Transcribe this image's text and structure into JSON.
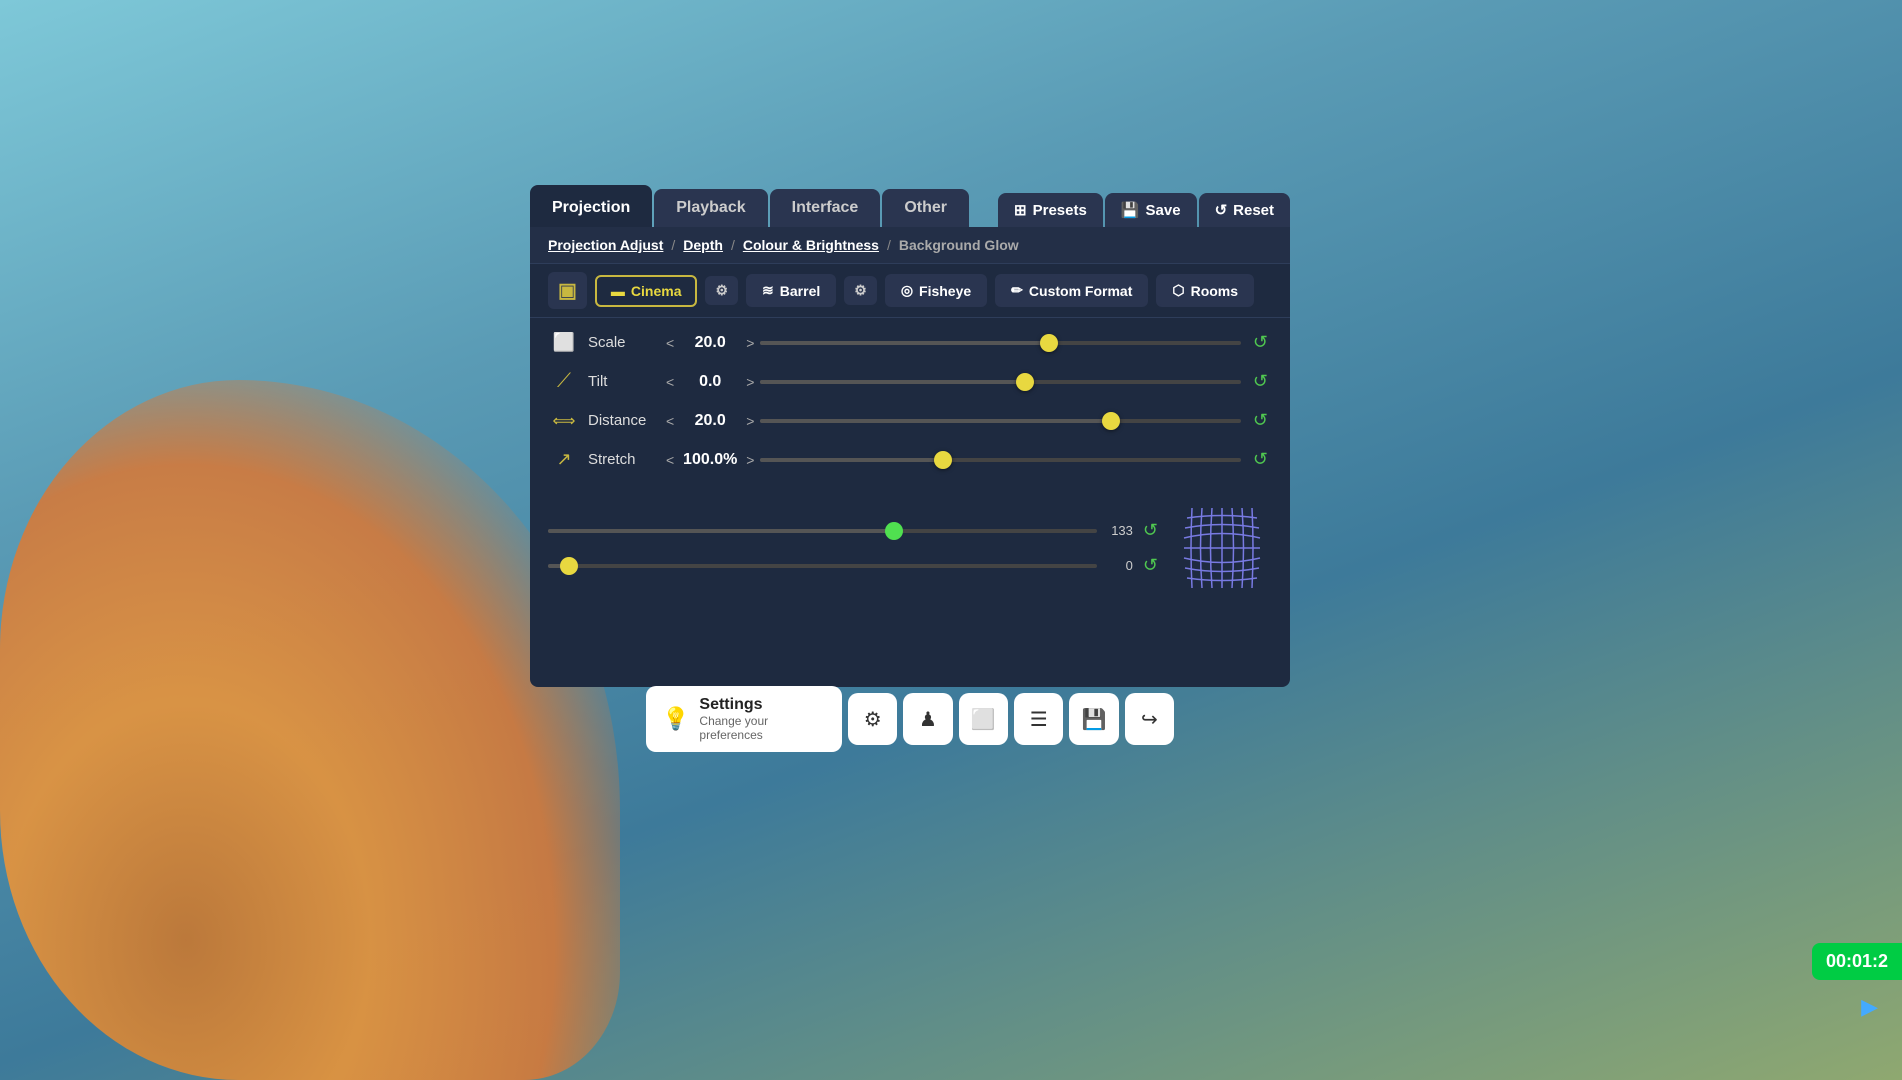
{
  "background": {
    "color_top": "#7ec8d8",
    "color_bottom": "#5a9bb5"
  },
  "tabs": {
    "main": [
      {
        "id": "projection",
        "label": "Projection",
        "active": true
      },
      {
        "id": "playback",
        "label": "Playback",
        "active": false
      },
      {
        "id": "interface",
        "label": "Interface",
        "active": false
      },
      {
        "id": "other",
        "label": "Other",
        "active": false
      }
    ],
    "actions": [
      {
        "id": "presets",
        "label": "Presets",
        "icon": "⊞"
      },
      {
        "id": "save",
        "label": "Save",
        "icon": "💾"
      },
      {
        "id": "reset",
        "label": "Reset",
        "icon": "↺"
      }
    ]
  },
  "breadcrumb": {
    "items": [
      {
        "label": "Projection Adjust",
        "active": true
      },
      {
        "label": "Depth",
        "active": true
      },
      {
        "label": "Colour & Brightness",
        "active": true
      },
      {
        "label": "Background Glow",
        "active": false
      }
    ]
  },
  "sub_tabs": [
    {
      "id": "screen-icon",
      "label": "",
      "icon_only": true,
      "icon": "▣"
    },
    {
      "id": "cinema",
      "label": "Cinema",
      "active": true,
      "icon": "▬"
    },
    {
      "id": "cinema-settings",
      "label": "",
      "icon_only": true,
      "icon": "⚙"
    },
    {
      "id": "barrel",
      "label": "Barrel",
      "active": false,
      "icon": "≋"
    },
    {
      "id": "barrel-settings",
      "label": "",
      "icon_only": true,
      "icon": "⚙"
    },
    {
      "id": "fisheye",
      "label": "Fisheye",
      "active": false,
      "icon": "◎"
    },
    {
      "id": "custom-format",
      "label": "Custom Format",
      "active": false,
      "icon": "✏"
    },
    {
      "id": "rooms",
      "label": "Rooms",
      "active": false,
      "icon": "⬡"
    }
  ],
  "sliders": [
    {
      "id": "scale",
      "label": "Scale",
      "icon": "⬜",
      "value": "20.0",
      "thumb_pct": 60,
      "thumb_color": "yellow"
    },
    {
      "id": "tilt",
      "label": "Tilt",
      "icon": "⟋",
      "value": "0.0",
      "thumb_pct": 55,
      "thumb_color": "yellow"
    },
    {
      "id": "distance",
      "label": "Distance",
      "icon": "⟺",
      "value": "20.0",
      "thumb_pct": 73,
      "thumb_color": "yellow"
    },
    {
      "id": "stretch",
      "label": "Stretch",
      "icon": "↗",
      "value": "100.0%",
      "thumb_pct": 38,
      "thumb_color": "yellow"
    }
  ],
  "distortion": {
    "top_value": "133",
    "top_thumb_pct": 63,
    "bottom_value": "0",
    "bottom_thumb_pct": 3
  },
  "bottom_toolbar": {
    "settings_title": "Settings",
    "settings_sub": "Change your preferences",
    "buttons": [
      {
        "id": "gear",
        "icon": "⚙",
        "label": "Settings"
      },
      {
        "id": "person",
        "icon": "♟",
        "label": "Person"
      },
      {
        "id": "screen",
        "icon": "⬜",
        "label": "Screen"
      },
      {
        "id": "menu",
        "icon": "☰",
        "label": "Menu"
      },
      {
        "id": "save",
        "icon": "💾",
        "label": "Save"
      },
      {
        "id": "export",
        "icon": "↪",
        "label": "Export"
      }
    ]
  },
  "timer": {
    "value": "00:01:2"
  }
}
